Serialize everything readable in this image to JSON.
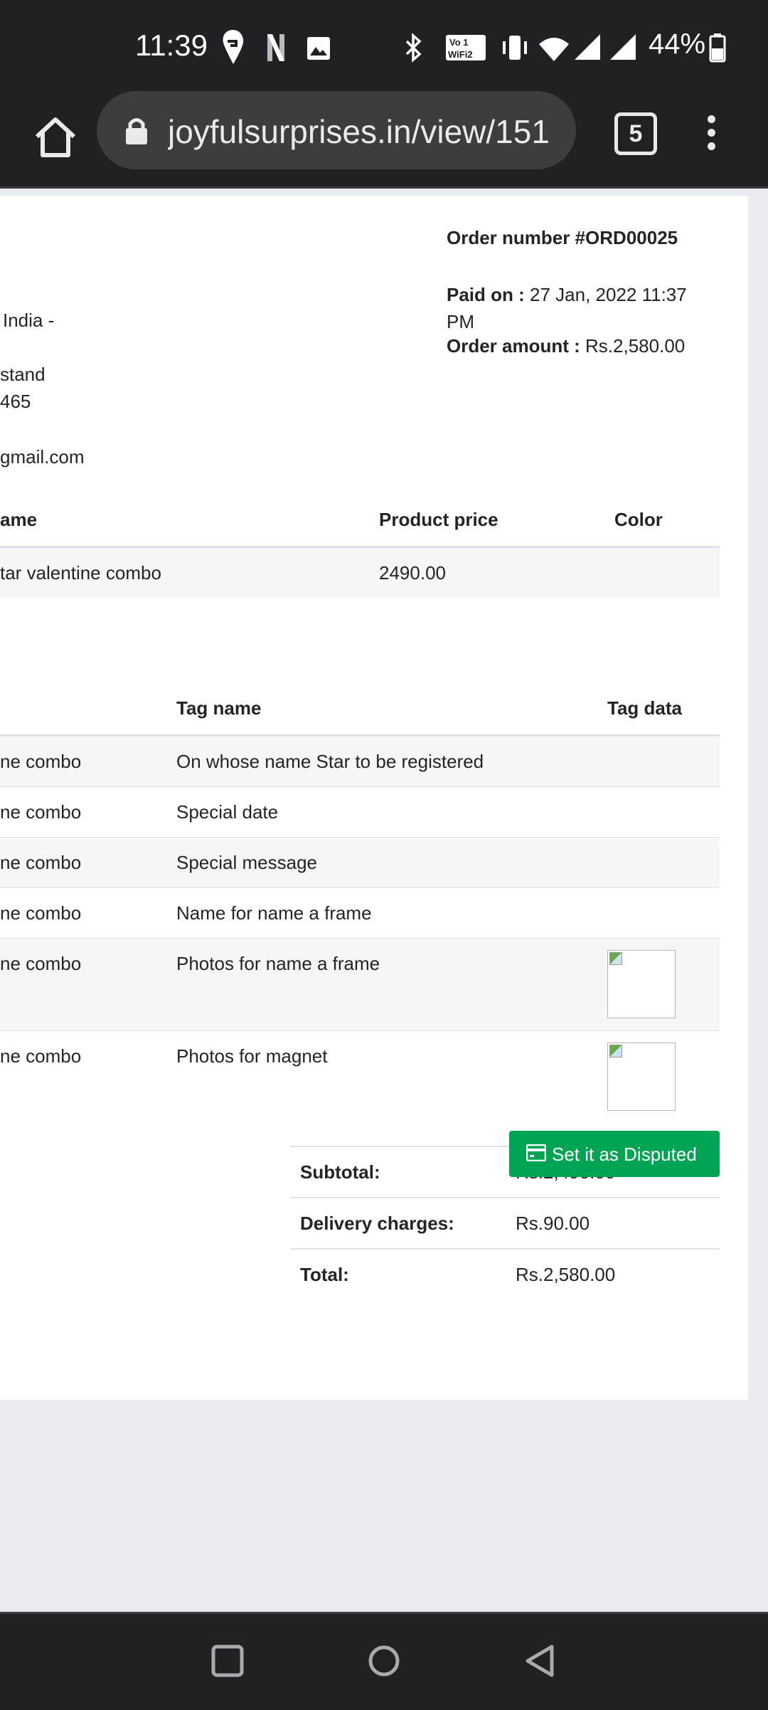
{
  "status": {
    "time": "11:39",
    "battery": "44%",
    "icons": [
      "swiggy-icon",
      "netflix-icon",
      "gallery-icon",
      "bluetooth-icon",
      "volte-wifi-icon",
      "vibrate-icon",
      "wifi-icon",
      "signal-icon",
      "signal-icon",
      "battery-icon"
    ]
  },
  "browser": {
    "url": "joyfulsurprises.in/view/151",
    "tab_count": "5"
  },
  "order": {
    "number": "Order number #ORD00025",
    "paid_label": "Paid on :",
    "paid_value": "27 Jan, 2022 11:37 PM",
    "amount_label": "Order amount :",
    "amount_value": "Rs.2,580.00"
  },
  "address": {
    "line1": "India -",
    "line2": "stand",
    "line3": "465",
    "email": "gmail.com"
  },
  "products": {
    "headers": [
      "ame",
      "Product price",
      "Color"
    ],
    "rows": [
      [
        "tar valentine combo",
        "2490.00",
        ""
      ]
    ]
  },
  "tags": {
    "headers": [
      "Tag name",
      "Tag data"
    ],
    "rows": [
      {
        "product": "ne combo",
        "tag": "On whose name Star to be registered",
        "data": ""
      },
      {
        "product": "ne combo",
        "tag": "Special date",
        "data": ""
      },
      {
        "product": "ne combo",
        "tag": "Special message",
        "data": ""
      },
      {
        "product": "ne combo",
        "tag": "Name for name a frame",
        "data": ""
      },
      {
        "product": "ne combo",
        "tag": "Photos for name a frame",
        "data": "image"
      },
      {
        "product": "ne combo",
        "tag": "Photos for magnet",
        "data": "image"
      }
    ]
  },
  "totals": {
    "subtotal_label": "Subtotal:",
    "subtotal_value": "Rs.2,490.00",
    "delivery_label": "Delivery charges:",
    "delivery_value": "Rs.90.00",
    "total_label": "Total:",
    "total_value": "Rs.2,580.00"
  },
  "actions": {
    "dispute_label": "Set it as Disputed",
    "button_color": "#00a453"
  }
}
